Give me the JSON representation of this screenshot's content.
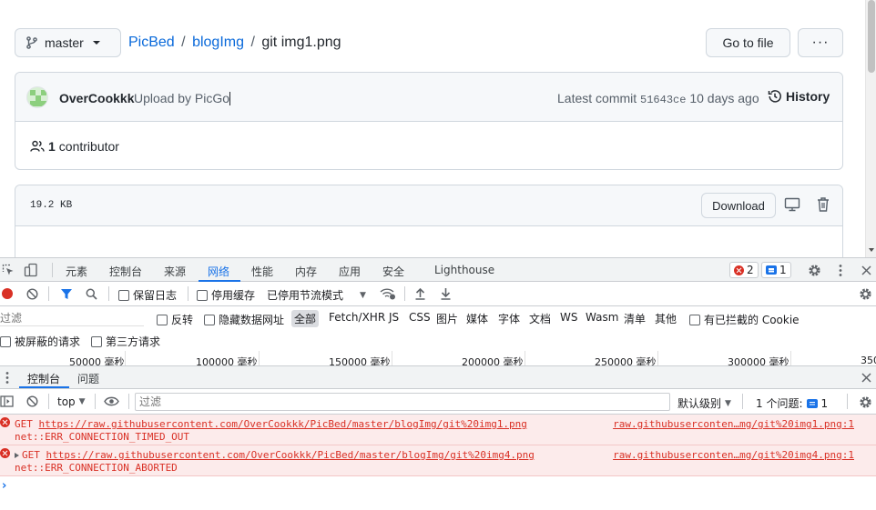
{
  "github": {
    "branch": "master",
    "breadcrumb": {
      "repo": "PicBed",
      "folder": "blogImg",
      "sep": "/",
      "file": "git img1.png"
    },
    "go_to_file": "Go to file",
    "more": "···",
    "commit": {
      "author": "OverCookkk",
      "message": "Upload by PicGo",
      "latest_label": "Latest commit",
      "sha": "51643ce",
      "age": "10 days ago",
      "history": "History"
    },
    "contributors": {
      "count": "1",
      "label": "contributor"
    },
    "file": {
      "size": "19.2 KB",
      "download": "Download"
    }
  },
  "devtools": {
    "tabs": [
      "元素",
      "控制台",
      "来源",
      "网络",
      "性能",
      "内存",
      "应用",
      "安全",
      "Lighthouse"
    ],
    "active_tab": "网络",
    "error_count": "2",
    "message_count": "1",
    "network_toolbar": {
      "preserve_log": "保留日志",
      "disable_cache": "停用缓存",
      "throttling": "已停用节流模式"
    },
    "filter_bar": {
      "placeholder": "过滤",
      "invert": "反转",
      "hide_data_urls": "隐藏数据网址",
      "types": [
        "全部",
        "Fetch/XHR",
        "JS",
        "CSS",
        "图片",
        "媒体",
        "字体",
        "文档",
        "WS",
        "Wasm",
        "清单",
        "其他"
      ],
      "selected_type": "全部",
      "blocked_cookies": "有已拦截的 Cookie",
      "blocked_requests": "被屏蔽的请求",
      "third_party": "第三方请求"
    },
    "timeline_ticks": [
      "50000 毫秒",
      "100000 毫秒",
      "150000 毫秒",
      "200000 毫秒",
      "250000 毫秒",
      "300000 毫秒",
      "350"
    ],
    "drawer": {
      "tabs": [
        "控制台",
        "问题"
      ],
      "active": "控制台",
      "context": "top",
      "filter_placeholder": "过滤",
      "levels": "默认级别",
      "issues_label": "1 个问题:",
      "issues_count": "1"
    },
    "console_errors": [
      {
        "method": "GET",
        "url": "https://raw.githubusercontent.com/OverCookkk/PicBed/master/blogImg/git%20img1.png",
        "error": "net::ERR_CONNECTION_TIMED_OUT",
        "source": "raw.githubuserconten…mg/git%20img1.png:1"
      },
      {
        "method": "GET",
        "url": "https://raw.githubusercontent.com/OverCookkk/PicBed/master/blogImg/git%20img4.png",
        "error": "net::ERR_CONNECTION_ABORTED",
        "source": "raw.githubuserconten…mg/git%20img4.png:1"
      }
    ],
    "prompt": "›",
    "colors": {
      "accent": "#1a73e8",
      "error": "#d93025",
      "error_bg": "#fcebeb"
    }
  }
}
